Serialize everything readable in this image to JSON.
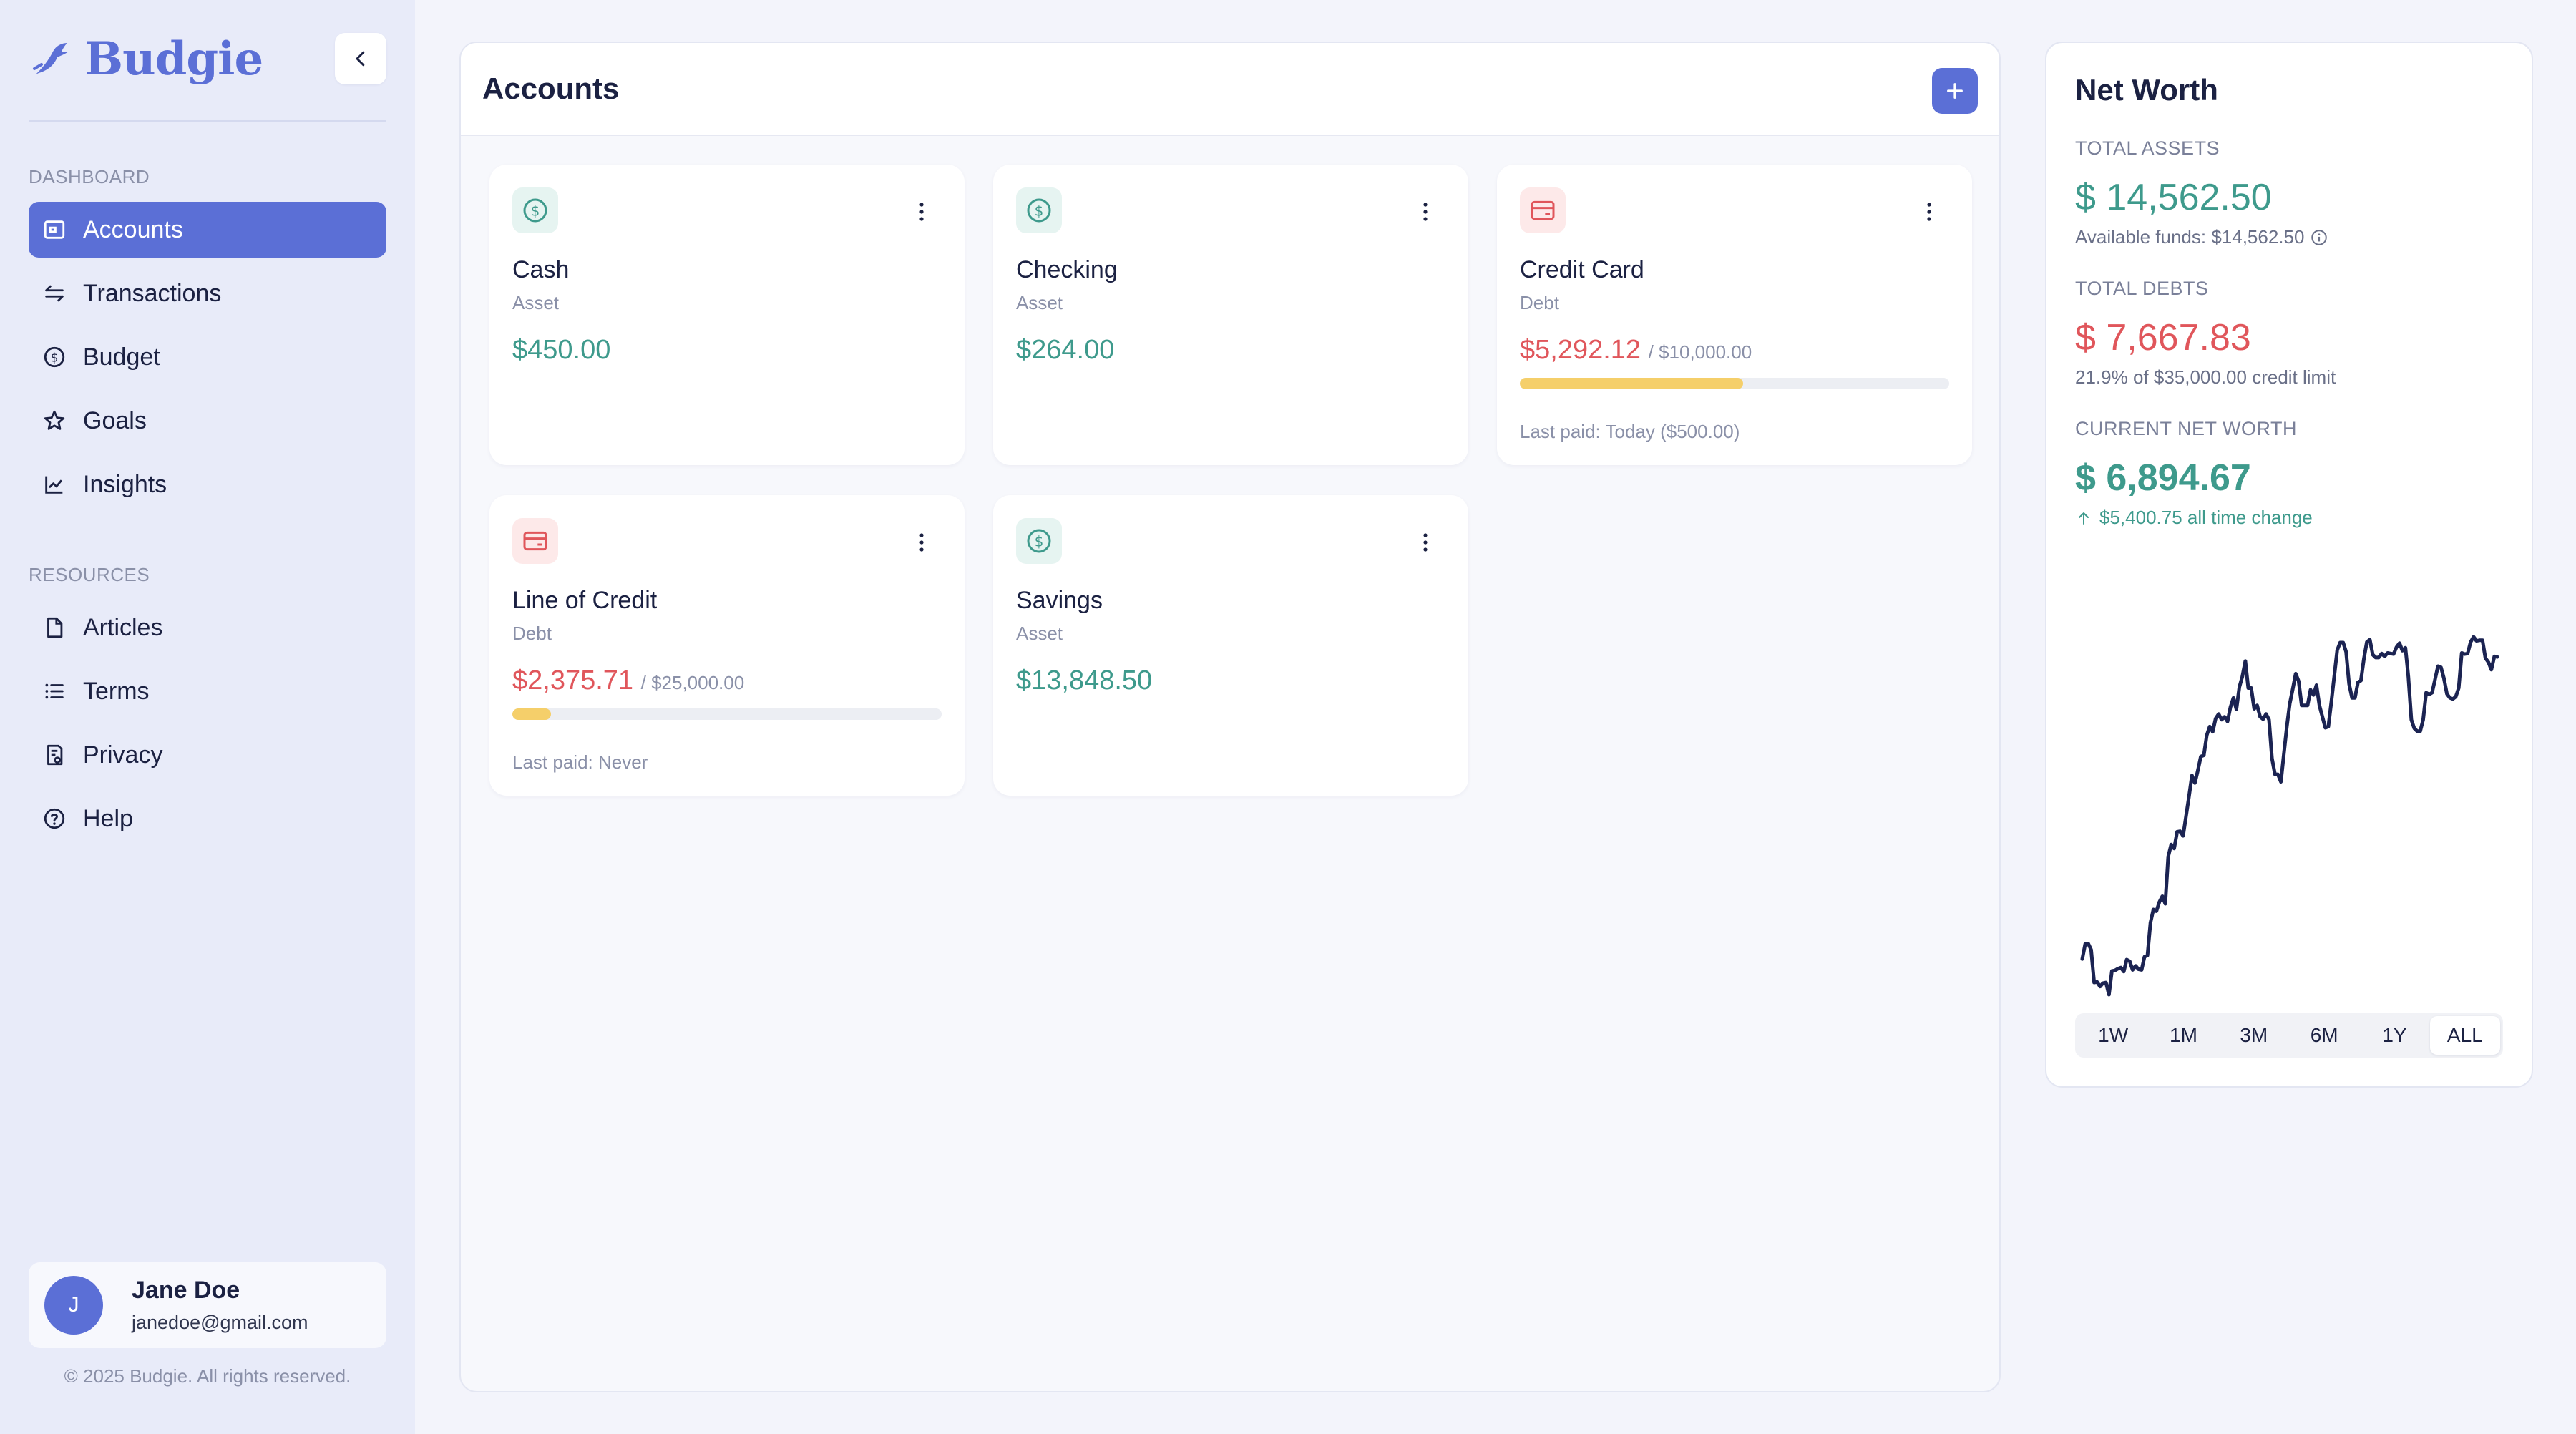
{
  "brand": {
    "name": "Budgie"
  },
  "sidebar": {
    "dashboard_label": "DASHBOARD",
    "dashboard_items": [
      {
        "label": "Accounts",
        "icon": "wallet-icon",
        "active": true
      },
      {
        "label": "Transactions",
        "icon": "arrows-exchange-icon"
      },
      {
        "label": "Budget",
        "icon": "dollar-circle-icon"
      },
      {
        "label": "Goals",
        "icon": "star-icon"
      },
      {
        "label": "Insights",
        "icon": "line-chart-icon"
      }
    ],
    "resources_label": "RESOURCES",
    "resource_items": [
      {
        "label": "Articles",
        "icon": "document-icon"
      },
      {
        "label": "Terms",
        "icon": "list-icon"
      },
      {
        "label": "Privacy",
        "icon": "privacy-document-icon"
      },
      {
        "label": "Help",
        "icon": "help-circle-icon"
      }
    ],
    "user": {
      "initial": "J",
      "name": "Jane Doe",
      "email": "janedoe@gmail.com"
    },
    "copyright": "© 2025 Budgie. All rights reserved."
  },
  "accounts": {
    "title": "Accounts",
    "cards": [
      {
        "name": "Cash",
        "type": "Asset",
        "balance": "$450.00"
      },
      {
        "name": "Checking",
        "type": "Asset",
        "balance": "$264.00"
      },
      {
        "name": "Credit Card",
        "type": "Debt",
        "balance": "$5,292.12",
        "limit": "/ $10,000.00",
        "utilization": 0.52,
        "last_paid": "Last paid: Today ($500.00)"
      },
      {
        "name": "Line of Credit",
        "type": "Debt",
        "balance": "$2,375.71",
        "limit": "/ $25,000.00",
        "utilization": 0.09,
        "last_paid": "Last paid: Never"
      },
      {
        "name": "Savings",
        "type": "Asset",
        "balance": "$13,848.50"
      }
    ]
  },
  "networth": {
    "title": "Net Worth",
    "total_assets_label": "TOTAL ASSETS",
    "total_assets": "$ 14,562.50",
    "available_funds": "Available funds: $14,562.50",
    "total_debts_label": "TOTAL DEBTS",
    "total_debts": "$ 7,667.83",
    "credit_usage": "21.9% of $35,000.00 credit limit",
    "current_label": "CURRENT NET WORTH",
    "current_value": "$ 6,894.67",
    "change": "$5,400.75 all time change",
    "ranges": [
      "1W",
      "1M",
      "3M",
      "6M",
      "1Y",
      "ALL"
    ],
    "active_range": "ALL"
  },
  "colors": {
    "accent": "#5b6fd6",
    "positive": "#3e9a8c",
    "negative": "#e0565b",
    "progress": "#f5cf6a",
    "chart_line": "#1b2352"
  },
  "chart_data": {
    "type": "line",
    "series": [
      {
        "values": [
          1640,
          1900,
          1910,
          1800,
          1230,
          1240,
          1160,
          1220,
          1230,
          1020,
          1430,
          1440,
          1470,
          1490,
          1420,
          1630,
          1600,
          1450,
          1520,
          1460,
          1450,
          1680,
          1700,
          2270,
          2500,
          2470,
          2630,
          2730,
          2600,
          3420,
          3630,
          3560,
          3850,
          3860,
          3780,
          4120,
          4460,
          4830,
          4700,
          4920,
          5160,
          5180,
          5530,
          5680,
          5590,
          5820,
          5900,
          5800,
          5850,
          5770,
          6020,
          6180,
          5980,
          6370,
          6550,
          6820,
          6350,
          6350,
          5990,
          6050,
          5850,
          5810,
          5900,
          5800,
          5130,
          4850,
          4850,
          4720,
          5200,
          5680,
          6080,
          6330,
          6600,
          6470,
          6050,
          6050,
          6050,
          6320,
          6230,
          6400,
          6050,
          5850,
          5660,
          5680,
          6100,
          6550,
          7010,
          7140,
          7140,
          6980,
          6420,
          6180,
          6180,
          6450,
          6480,
          6860,
          7150,
          7190,
          6930,
          6880,
          6880,
          6950,
          6900,
          6960,
          6950,
          6940,
          7060,
          7130,
          7000,
          7050,
          6550,
          5800,
          5650,
          5600,
          5600,
          5800,
          6270,
          6240,
          6270,
          6500,
          6730,
          6710,
          6520,
          6250,
          6180,
          6160,
          6200,
          6350,
          6960,
          6940,
          6950,
          7150,
          7240,
          7170,
          7180,
          7180,
          6870,
          6800,
          6670,
          6900,
          6890
        ]
      }
    ]
  }
}
